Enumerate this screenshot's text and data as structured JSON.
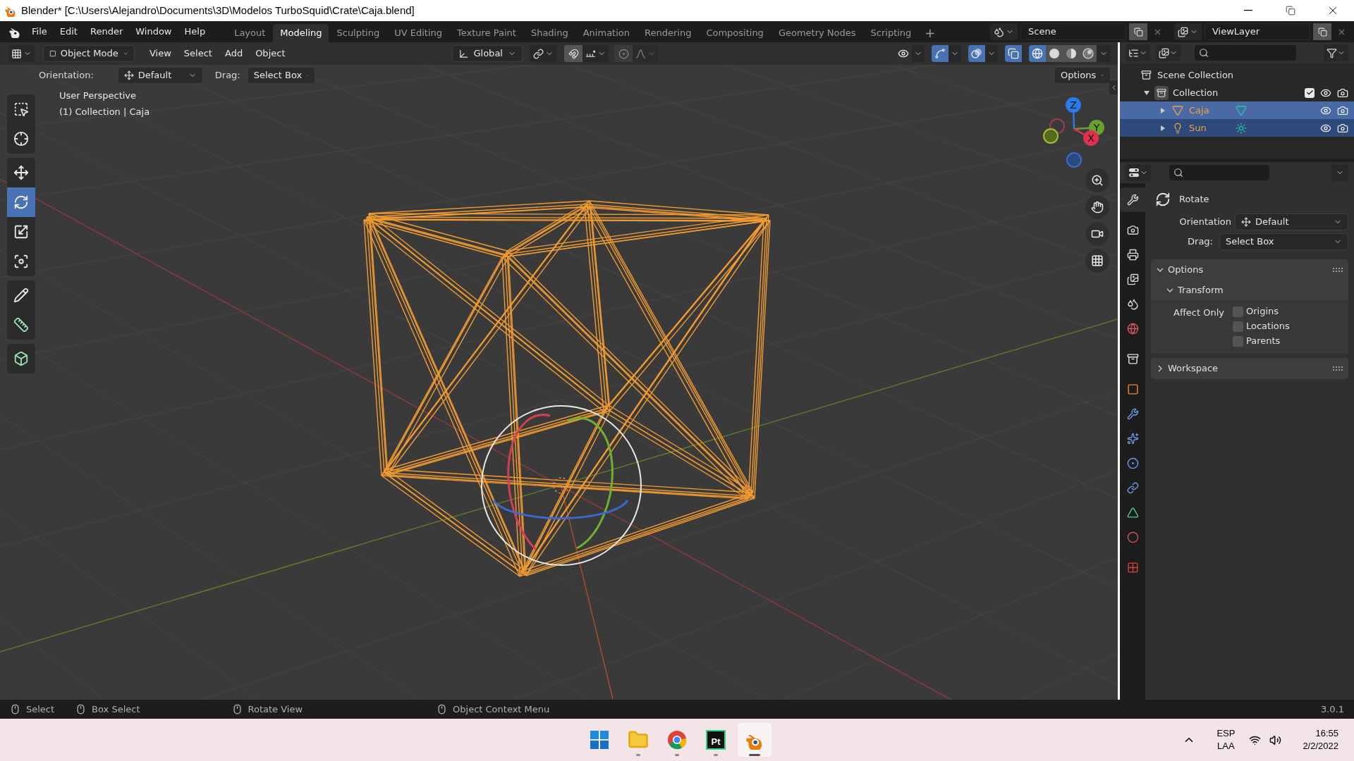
{
  "window": {
    "title": "Blender* [C:\\Users\\Alejandro\\Documents\\3D\\Modelos TurboSquid\\Crate\\Caja.blend]"
  },
  "menu": [
    "File",
    "Edit",
    "Render",
    "Window",
    "Help"
  ],
  "workspaces": [
    {
      "label": "Layout",
      "selected": false
    },
    {
      "label": "Modeling",
      "selected": true
    },
    {
      "label": "Sculpting",
      "selected": false
    },
    {
      "label": "UV Editing",
      "selected": false
    },
    {
      "label": "Texture Paint",
      "selected": false
    },
    {
      "label": "Shading",
      "selected": false
    },
    {
      "label": "Animation",
      "selected": false
    },
    {
      "label": "Rendering",
      "selected": false
    },
    {
      "label": "Compositing",
      "selected": false
    },
    {
      "label": "Geometry Nodes",
      "selected": false
    },
    {
      "label": "Scripting",
      "selected": false
    }
  ],
  "add_workspace": "+",
  "scene": "Scene",
  "view_layer": "ViewLayer",
  "viewport_header": {
    "mode": "Object Mode",
    "menus": [
      "View",
      "Select",
      "Add",
      "Object"
    ],
    "orientation": "Global",
    "toggles": [
      {
        "kind": "visibility",
        "on": false
      },
      {
        "kind": "gizmos",
        "on": true
      },
      {
        "kind": "overlays",
        "on": true
      },
      {
        "kind": "xray",
        "on": true
      }
    ],
    "shading": [
      {
        "kind": "wireframe",
        "selected": true
      },
      {
        "kind": "solid",
        "selected": false
      },
      {
        "kind": "material",
        "selected": false
      },
      {
        "kind": "rendered",
        "selected": false
      }
    ]
  },
  "tool_settings": {
    "orientation_label": "Orientation:",
    "orientation": "Default",
    "drag_label": "Drag:",
    "drag": "Select Box",
    "options": "Options"
  },
  "viewport": {
    "view_name": "User Perspective",
    "object_info": "(1) Collection | Caja",
    "axes": [
      {
        "kind": "z",
        "label": "Z"
      },
      {
        "kind": "y",
        "label": "Y"
      },
      {
        "kind": "x",
        "label": "X"
      }
    ]
  },
  "toolbar": {
    "groups": [
      [
        {
          "kind": "select_box",
          "selected": false
        },
        {
          "kind": "cursor",
          "selected": false
        }
      ],
      [
        {
          "kind": "move",
          "selected": false
        },
        {
          "kind": "rotate",
          "selected": true
        },
        {
          "kind": "scale",
          "selected": false
        },
        {
          "kind": "transform",
          "selected": false
        }
      ],
      [
        {
          "kind": "annotate",
          "selected": false
        },
        {
          "kind": "measure",
          "selected": false
        }
      ],
      [
        {
          "kind": "add_cube",
          "selected": false
        }
      ]
    ]
  },
  "outliner": {
    "root": "Scene Collection",
    "collections": [
      {
        "label": "Collection",
        "checked": true,
        "expanded": true,
        "children": [
          {
            "label": "Caja",
            "kind": "mesh",
            "expanded": false,
            "selected": true,
            "active": true
          },
          {
            "label": "Sun",
            "kind": "light",
            "expanded": false,
            "selected": true,
            "active": false
          }
        ]
      }
    ]
  },
  "properties": {
    "tab_groups": [
      [
        {
          "kind": "tool",
          "selected": true
        }
      ],
      [
        {
          "kind": "render",
          "selected": false
        },
        {
          "kind": "output",
          "selected": false
        },
        {
          "kind": "view_layer",
          "selected": false
        },
        {
          "kind": "scene",
          "selected": false
        },
        {
          "kind": "world",
          "selected": false
        }
      ],
      [
        {
          "kind": "collection",
          "selected": false
        }
      ],
      [
        {
          "kind": "object",
          "selected": false
        },
        {
          "kind": "modifiers",
          "selected": false
        },
        {
          "kind": "particles",
          "selected": false
        },
        {
          "kind": "physics",
          "selected": false
        },
        {
          "kind": "constraints",
          "selected": false
        },
        {
          "kind": "data",
          "selected": false
        },
        {
          "kind": "material",
          "selected": false
        }
      ],
      [
        {
          "kind": "texture",
          "selected": false
        }
      ]
    ],
    "tool": "Rotate",
    "orientation_label": "Orientation",
    "orientation": "Default",
    "drag_label": "Drag:",
    "drag": "Select Box",
    "panels": [
      {
        "label": "Options",
        "expanded": true,
        "subpanels": [
          {
            "label": "Transform",
            "expanded": true,
            "affect_label": "Affect Only",
            "checkboxes": [
              {
                "label": "Origins",
                "checked": false
              },
              {
                "label": "Locations",
                "checked": false
              },
              {
                "label": "Parents",
                "checked": false
              }
            ]
          }
        ]
      },
      {
        "label": "Workspace",
        "expanded": false
      }
    ]
  },
  "status_bar": {
    "hints": [
      {
        "kind": "left",
        "label": "Select"
      },
      {
        "kind": "drag",
        "label": "Box Select"
      },
      {
        "kind": "middle",
        "label": "Rotate View"
      },
      {
        "kind": "right",
        "label": "Object Context Menu"
      }
    ],
    "version": "3.0.1"
  },
  "taskbar": {
    "apps": [
      {
        "kind": "start",
        "running": false,
        "active": false
      },
      {
        "kind": "files",
        "running": true,
        "active": false
      },
      {
        "kind": "browser",
        "running": true,
        "active": false
      },
      {
        "kind": "ide",
        "label": "Pt",
        "running": true,
        "active": false
      },
      {
        "kind": "blender",
        "running": true,
        "active": true
      }
    ],
    "language": "ESP",
    "layout": "LAA",
    "time": "16:55",
    "date": "2/2/2022"
  }
}
